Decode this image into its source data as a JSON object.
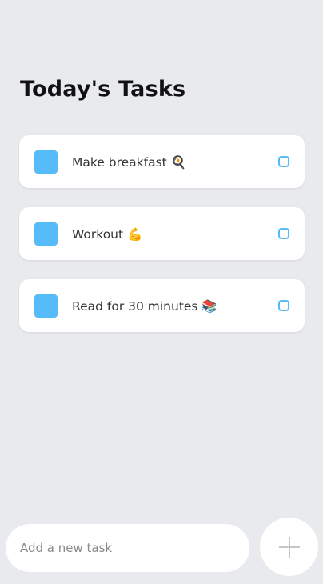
{
  "header": {
    "title": "Today's Tasks"
  },
  "tasks": [
    {
      "label": "Make breakfast 🍳"
    },
    {
      "label": "Workout 💪"
    },
    {
      "label": "Read for 30 minutes 📚"
    }
  ],
  "composer": {
    "placeholder": "Add a new task",
    "add_icon": "plus-icon"
  },
  "colors": {
    "background": "#e8eaed",
    "accent": "#55bcf9",
    "card": "#ffffff"
  }
}
